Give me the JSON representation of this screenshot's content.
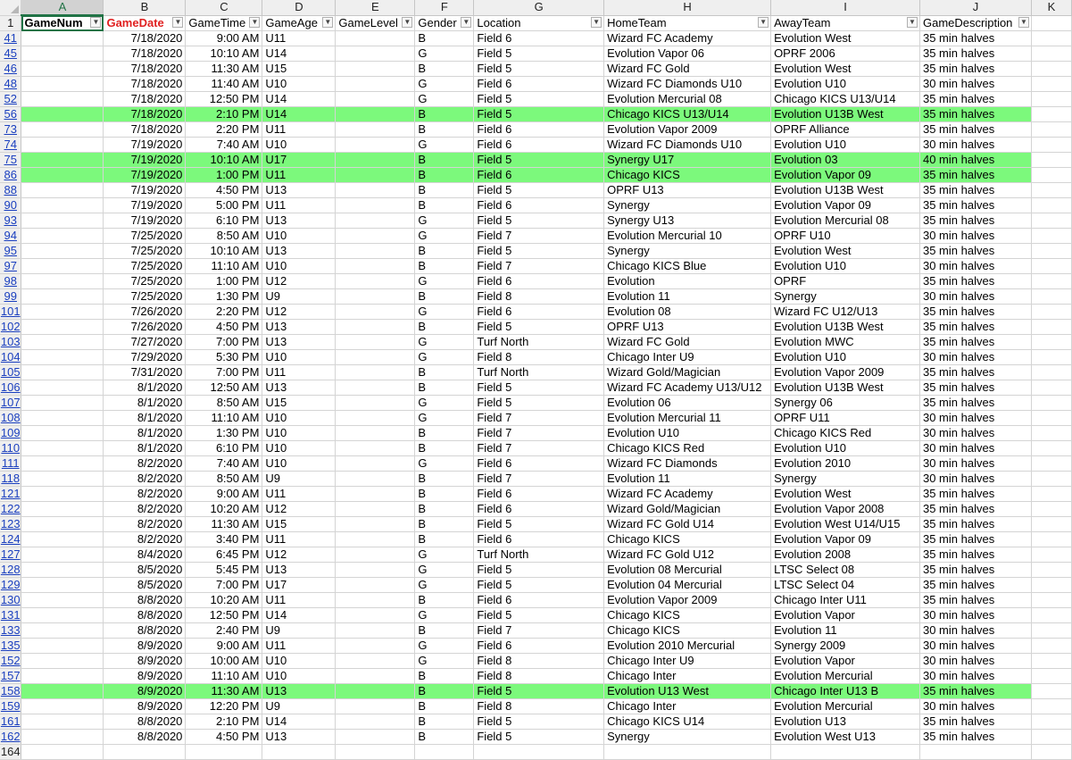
{
  "columns": [
    "A",
    "B",
    "C",
    "D",
    "E",
    "F",
    "G",
    "H",
    "I",
    "J",
    "K"
  ],
  "header_row_num": "1",
  "headers": [
    "GameNum",
    "GameDate",
    "GameTime",
    "GameAge",
    "GameLevel",
    "Gender",
    "Location",
    "HomeTeam",
    "AwayTeam",
    "GameDescription"
  ],
  "highlight_color": "#7cf97c",
  "selected_cell": "A1",
  "rows": [
    {
      "num": "41",
      "date": "7/18/2020",
      "time": "9:00 AM",
      "age": "U11",
      "gender": "B",
      "location": "Field 6",
      "home": "Wizard FC Academy",
      "away": "Evolution West",
      "desc": "35 min halves",
      "hl": false
    },
    {
      "num": "45",
      "date": "7/18/2020",
      "time": "10:10 AM",
      "age": "U14",
      "gender": "G",
      "location": "Field 5",
      "home": "Evolution Vapor 06",
      "away": "OPRF 2006",
      "desc": "35 min halves",
      "hl": false
    },
    {
      "num": "46",
      "date": "7/18/2020",
      "time": "11:30 AM",
      "age": "U15",
      "gender": "B",
      "location": "Field 5",
      "home": "Wizard FC Gold",
      "away": "Evolution West",
      "desc": "35 min halves",
      "hl": false
    },
    {
      "num": "48",
      "date": "7/18/2020",
      "time": "11:40 AM",
      "age": "U10",
      "gender": "G",
      "location": "Field 6",
      "home": "Wizard FC Diamonds U10",
      "away": "Evolution U10",
      "desc": "30 min halves",
      "hl": false
    },
    {
      "num": "52",
      "date": "7/18/2020",
      "time": "12:50 PM",
      "age": "U14",
      "gender": "G",
      "location": "Field 5",
      "home": "Evolution Mercurial 08",
      "away": "Chicago KICS U13/U14",
      "desc": "35 min halves",
      "hl": false
    },
    {
      "num": "56",
      "date": "7/18/2020",
      "time": "2:10 PM",
      "age": "U14",
      "gender": "B",
      "location": "Field 5",
      "home": "Chicago KICS U13/U14",
      "away": "Evolution U13B West",
      "desc": "35 min halves",
      "hl": true
    },
    {
      "num": "73",
      "date": "7/18/2020",
      "time": "2:20 PM",
      "age": "U11",
      "gender": "B",
      "location": "Field 6",
      "home": "Evolution Vapor 2009",
      "away": "OPRF Alliance",
      "desc": "35 min halves",
      "hl": false
    },
    {
      "num": "74",
      "date": "7/19/2020",
      "time": "7:40 AM",
      "age": "U10",
      "gender": "G",
      "location": "Field 6",
      "home": "Wizard FC Diamonds U10",
      "away": "Evolution U10",
      "desc": "30 min halves",
      "hl": false
    },
    {
      "num": "75",
      "date": "7/19/2020",
      "time": "10:10 AM",
      "age": "U17",
      "gender": "B",
      "location": "Field 5",
      "home": "Synergy U17",
      "away": "Evolution 03",
      "desc": "40 min halves",
      "hl": true
    },
    {
      "num": "86",
      "date": "7/19/2020",
      "time": "1:00 PM",
      "age": "U11",
      "gender": "B",
      "location": "Field 6",
      "home": "Chicago KICS",
      "away": "Evolution Vapor 09",
      "desc": "35 min halves",
      "hl": true
    },
    {
      "num": "88",
      "date": "7/19/2020",
      "time": "4:50 PM",
      "age": "U13",
      "gender": "B",
      "location": "Field 5",
      "home": "OPRF U13",
      "away": "Evolution U13B West",
      "desc": "35 min halves",
      "hl": false
    },
    {
      "num": "90",
      "date": "7/19/2020",
      "time": "5:00 PM",
      "age": "U11",
      "gender": "B",
      "location": "Field 6",
      "home": "Synergy",
      "away": "Evolution Vapor 09",
      "desc": "35 min halves",
      "hl": false
    },
    {
      "num": "93",
      "date": "7/19/2020",
      "time": "6:10 PM",
      "age": "U13",
      "gender": "G",
      "location": "Field 5",
      "home": "Synergy U13",
      "away": "Evolution Mercurial 08",
      "desc": "35 min halves",
      "hl": false
    },
    {
      "num": "94",
      "date": "7/25/2020",
      "time": "8:50 AM",
      "age": "U10",
      "gender": "G",
      "location": "Field 7",
      "home": "Evolution Mercurial 10",
      "away": "OPRF U10",
      "desc": "30 min halves",
      "hl": false
    },
    {
      "num": "95",
      "date": "7/25/2020",
      "time": "10:10 AM",
      "age": "U13",
      "gender": "B",
      "location": "Field 5",
      "home": "Synergy",
      "away": "Evolution West",
      "desc": "35 min halves",
      "hl": false
    },
    {
      "num": "97",
      "date": "7/25/2020",
      "time": "11:10 AM",
      "age": "U10",
      "gender": "B",
      "location": "Field 7",
      "home": "Chicago KICS Blue",
      "away": "Evolution U10",
      "desc": "30 min halves",
      "hl": false
    },
    {
      "num": "98",
      "date": "7/25/2020",
      "time": "1:00 PM",
      "age": "U12",
      "gender": "G",
      "location": "Field 6",
      "home": "Evolution",
      "away": "OPRF",
      "desc": "35 min halves",
      "hl": false
    },
    {
      "num": "99",
      "date": "7/25/2020",
      "time": "1:30 PM",
      "age": "U9",
      "gender": "B",
      "location": "Field 8",
      "home": "Evolution 11",
      "away": "Synergy",
      "desc": "30 min halves",
      "hl": false
    },
    {
      "num": "101",
      "date": "7/26/2020",
      "time": "2:20 PM",
      "age": "U12",
      "gender": "G",
      "location": "Field 6",
      "home": "Evolution 08",
      "away": "Wizard FC U12/U13",
      "desc": "35 min halves",
      "hl": false
    },
    {
      "num": "102",
      "date": "7/26/2020",
      "time": "4:50 PM",
      "age": "U13",
      "gender": "B",
      "location": "Field 5",
      "home": "OPRF U13",
      "away": "Evolution U13B West",
      "desc": "35 min halves",
      "hl": false
    },
    {
      "num": "103",
      "date": "7/27/2020",
      "time": "7:00 PM",
      "age": "U13",
      "gender": "G",
      "location": "Turf North",
      "home": "Wizard FC Gold",
      "away": "Evolution MWC",
      "desc": "35 min halves",
      "hl": false
    },
    {
      "num": "104",
      "date": "7/29/2020",
      "time": "5:30 PM",
      "age": "U10",
      "gender": "G",
      "location": "Field 8",
      "home": "Chicago Inter U9",
      "away": "Evolution U10",
      "desc": "30 min halves",
      "hl": false
    },
    {
      "num": "105",
      "date": "7/31/2020",
      "time": "7:00 PM",
      "age": "U11",
      "gender": "B",
      "location": "Turf North",
      "home": "Wizard Gold/Magician",
      "away": "Evolution Vapor 2009",
      "desc": "35 min halves",
      "hl": false
    },
    {
      "num": "106",
      "date": "8/1/2020",
      "time": "12:50 AM",
      "age": "U13",
      "gender": "B",
      "location": "Field 5",
      "home": "Wizard FC Academy U13/U12",
      "away": "Evolution U13B West",
      "desc": "35 min halves",
      "hl": false
    },
    {
      "num": "107",
      "date": "8/1/2020",
      "time": "8:50 AM",
      "age": "U15",
      "gender": "G",
      "location": "Field 5",
      "home": "Evolution 06",
      "away": "Synergy 06",
      "desc": "35 min halves",
      "hl": false
    },
    {
      "num": "108",
      "date": "8/1/2020",
      "time": "11:10 AM",
      "age": "U10",
      "gender": "G",
      "location": "Field 7",
      "home": "Evolution Mercurial 11",
      "away": "OPRF U11",
      "desc": "30 min halves",
      "hl": false
    },
    {
      "num": "109",
      "date": "8/1/2020",
      "time": "1:30 PM",
      "age": "U10",
      "gender": "B",
      "location": "Field 7",
      "home": "Evolution U10",
      "away": "Chicago KICS Red",
      "desc": "30 min halves",
      "hl": false
    },
    {
      "num": "110",
      "date": "8/1/2020",
      "time": "6:10 PM",
      "age": "U10",
      "gender": "B",
      "location": "Field 7",
      "home": "Chicago KICS Red",
      "away": "Evolution U10",
      "desc": "30 min halves",
      "hl": false
    },
    {
      "num": "111",
      "date": "8/2/2020",
      "time": "7:40 AM",
      "age": "U10",
      "gender": "G",
      "location": "Field 6",
      "home": "Wizard FC Diamonds",
      "away": "Evolution 2010",
      "desc": "30 min halves",
      "hl": false
    },
    {
      "num": "118",
      "date": "8/2/2020",
      "time": "8:50 AM",
      "age": "U9",
      "gender": "B",
      "location": "Field 7",
      "home": "Evolution 11",
      "away": "Synergy",
      "desc": "30 min halves",
      "hl": false
    },
    {
      "num": "121",
      "date": "8/2/2020",
      "time": "9:00 AM",
      "age": "U11",
      "gender": "B",
      "location": "Field 6",
      "home": "Wizard FC Academy",
      "away": "Evolution West",
      "desc": "35 min halves",
      "hl": false
    },
    {
      "num": "122",
      "date": "8/2/2020",
      "time": "10:20 AM",
      "age": "U12",
      "gender": "B",
      "location": "Field 6",
      "home": "Wizard Gold/Magician",
      "away": "Evolution Vapor 2008",
      "desc": "35 min halves",
      "hl": false
    },
    {
      "num": "123",
      "date": "8/2/2020",
      "time": "11:30 AM",
      "age": "U15",
      "gender": "B",
      "location": "Field 5",
      "home": "Wizard FC Gold U14",
      "away": "Evolution West U14/U15",
      "desc": "35 min halves",
      "hl": false
    },
    {
      "num": "124",
      "date": "8/2/2020",
      "time": "3:40 PM",
      "age": "U11",
      "gender": "B",
      "location": "Field 6",
      "home": "Chicago KICS",
      "away": "Evolution Vapor 09",
      "desc": "35 min halves",
      "hl": false
    },
    {
      "num": "127",
      "date": "8/4/2020",
      "time": "6:45 PM",
      "age": "U12",
      "gender": "G",
      "location": "Turf North",
      "home": "Wizard FC Gold U12",
      "away": "Evolution 2008",
      "desc": "35 min halves",
      "hl": false
    },
    {
      "num": "128",
      "date": "8/5/2020",
      "time": "5:45 PM",
      "age": "U13",
      "gender": "G",
      "location": "Field 5",
      "home": "Evolution 08 Mercurial",
      "away": "LTSC Select 08",
      "desc": "35 min halves",
      "hl": false
    },
    {
      "num": "129",
      "date": "8/5/2020",
      "time": "7:00 PM",
      "age": "U17",
      "gender": "G",
      "location": "Field 5",
      "home": "Evolution 04 Mercurial",
      "away": "LTSC Select 04",
      "desc": "35 min halves",
      "hl": false
    },
    {
      "num": "130",
      "date": "8/8/2020",
      "time": "10:20 AM",
      "age": "U11",
      "gender": "B",
      "location": "Field 6",
      "home": "Evolution Vapor 2009",
      "away": "Chicago Inter U11",
      "desc": "35 min halves",
      "hl": false
    },
    {
      "num": "131",
      "date": "8/8/2020",
      "time": "12:50 PM",
      "age": "U14",
      "gender": "G",
      "location": "Field 5",
      "home": "Chicago KICS",
      "away": "Evolution Vapor",
      "desc": "30 min halves",
      "hl": false
    },
    {
      "num": "133",
      "date": "8/8/2020",
      "time": "2:40 PM",
      "age": "U9",
      "gender": "B",
      "location": "Field 7",
      "home": "Chicago KICS",
      "away": "Evolution 11",
      "desc": "30 min halves",
      "hl": false
    },
    {
      "num": "135",
      "date": "8/9/2020",
      "time": "9:00 AM",
      "age": "U11",
      "gender": "G",
      "location": "Field 6",
      "home": "Evolution 2010 Mercurial",
      "away": "Synergy 2009",
      "desc": "30 min halves",
      "hl": false
    },
    {
      "num": "152",
      "date": "8/9/2020",
      "time": "10:00 AM",
      "age": "U10",
      "gender": "G",
      "location": "Field 8",
      "home": "Chicago Inter U9",
      "away": "Evolution Vapor",
      "desc": "30 min halves",
      "hl": false
    },
    {
      "num": "157",
      "date": "8/9/2020",
      "time": "11:10 AM",
      "age": "U10",
      "gender": "B",
      "location": "Field 8",
      "home": "Chicago Inter",
      "away": "Evolution Mercurial",
      "desc": "30 min halves",
      "hl": false
    },
    {
      "num": "158",
      "date": "8/9/2020",
      "time": "11:30 AM",
      "age": "U13",
      "gender": "B",
      "location": "Field 5",
      "home": "Evolution U13 West",
      "away": "Chicago Inter U13 B",
      "desc": "35 min halves",
      "hl": true
    },
    {
      "num": "159",
      "date": "8/9/2020",
      "time": "12:20 PM",
      "age": "U9",
      "gender": "B",
      "location": "Field 8",
      "home": "Chicago Inter",
      "away": "Evolution Mercurial",
      "desc": "30 min halves",
      "hl": false
    },
    {
      "num": "161",
      "date": "8/8/2020",
      "time": "2:10 PM",
      "age": "U14",
      "gender": "B",
      "location": "Field 5",
      "home": "Chicago KICS U14",
      "away": "Evolution U13",
      "desc": "35 min halves",
      "hl": false
    },
    {
      "num": "162",
      "date": "8/8/2020",
      "time": "4:50 PM",
      "age": "U13",
      "gender": "B",
      "location": "Field 5",
      "home": "Synergy",
      "away": "Evolution West U13",
      "desc": "35 min halves",
      "hl": false
    }
  ],
  "trailing_row_num": "164"
}
